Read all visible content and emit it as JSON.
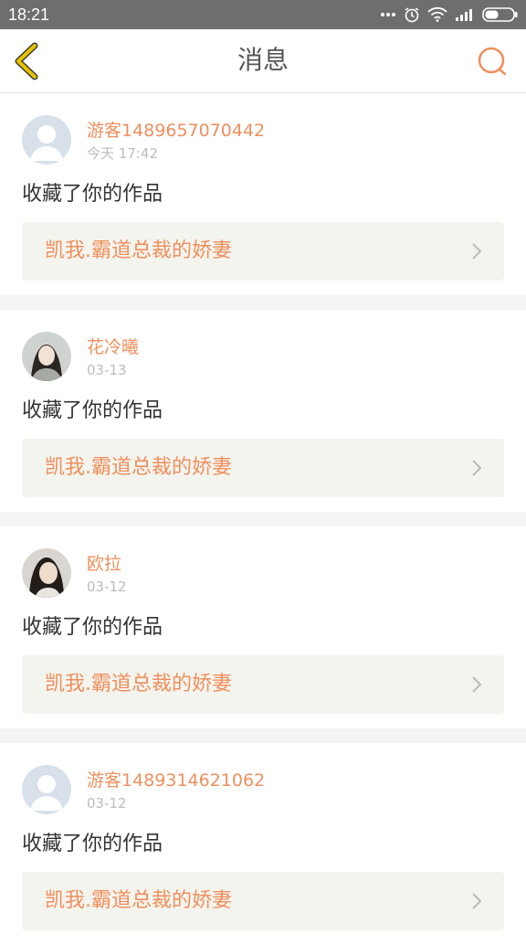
{
  "status_bar": {
    "time": "18:21"
  },
  "header": {
    "title": "消息"
  },
  "messages": [
    {
      "username": "游客1489657070442",
      "date": "今天 17:42",
      "action": "收藏了你的作品",
      "work_title": "凯我.霸道总裁的娇妻",
      "avatar": "default"
    },
    {
      "username": "花冷曦",
      "date": "03-13",
      "action": "收藏了你的作品",
      "work_title": "凯我.霸道总裁的娇妻",
      "avatar": "photo"
    },
    {
      "username": "欧拉",
      "date": "03-12",
      "action": "收藏了你的作品",
      "work_title": "凯我.霸道总裁的娇妻",
      "avatar": "photo"
    },
    {
      "username": "游客1489314621062",
      "date": "03-12",
      "action": "收藏了你的作品",
      "work_title": "凯我.霸道总裁的娇妻",
      "avatar": "default"
    }
  ],
  "colors": {
    "accent": "#ef8f5d",
    "back_icon": "#e6c300",
    "card_bg": "#f4f4ee"
  }
}
